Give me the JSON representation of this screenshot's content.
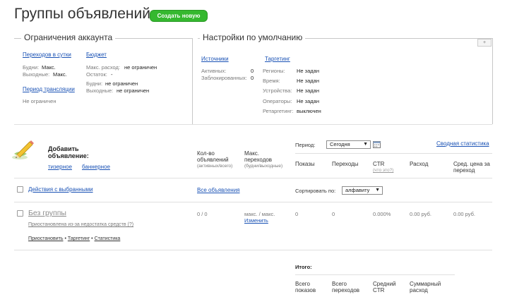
{
  "page": {
    "title": "Группы объявлений",
    "create_button": "Создать новую"
  },
  "account_limits": {
    "title": "Ограничения аккаунта",
    "clicks": {
      "link": "Переходов в сутки",
      "weekdays_label": "Будни:",
      "weekdays_value": "Макс.",
      "weekends_label": "Выходные:",
      "weekends_value": "Макс."
    },
    "budget": {
      "link": "Бюджет",
      "max_spend_label": "Макс. расход:",
      "max_spend_value": "не ограничен",
      "balance_label": "Остаток:",
      "balance_value": "-",
      "weekdays_label": "Будни:",
      "weekdays_value": "не ограничен",
      "weekends_label": "Выходные:",
      "weekends_value": "не ограничен"
    },
    "broadcast": {
      "link": "Период трансляции",
      "value": "Не ограничен"
    }
  },
  "defaults": {
    "title": "Настройки по умолчанию",
    "collapse": "+",
    "sources": {
      "link": "Источники",
      "active_label": "Активных:",
      "active_value": "0",
      "blocked_label": "Заблокированных:",
      "blocked_value": "0"
    },
    "targeting": {
      "link": "Таргетинг",
      "rows": [
        {
          "label": "Регионы:",
          "value": "Не задан"
        },
        {
          "label": "Время:",
          "value": "Не задан"
        },
        {
          "label": "Устройства:",
          "value": "Не задан"
        },
        {
          "label": "Операторы:",
          "value": "Не задан"
        },
        {
          "label": "Ретаргетинг:",
          "value": "выключен"
        }
      ]
    }
  },
  "ads": {
    "add_title": "Добавить объявление:",
    "add_teaser": "тизерное",
    "add_banner": "баннерное",
    "col_count": "Кол-во объявлений",
    "col_count_sub": "(активных/всего)",
    "col_max_clicks": "Макс. переходов",
    "col_max_clicks_sub": "(будни/выходные)",
    "period_label": "Период:",
    "period_value": "Сегодня",
    "summary_link": "Сводная статистика",
    "col_impressions": "Показы",
    "col_clicks": "Переходы",
    "col_ctr": "CTR",
    "col_ctr_sub": "(что это?)",
    "col_spend": "Расход",
    "col_avg_price": "Сред. цена за переход",
    "bulk_actions": "Действия с выбранными",
    "all_ads": "Все объявления",
    "sort_label": "Сортировать по:",
    "sort_value": "алфавиту"
  },
  "group_row": {
    "name": "Без группы",
    "status": "Приостановлена из-за недостатка средств (?)",
    "count": "0 / 0",
    "max_clicks": "макс. / макс.",
    "change": "Изменить",
    "impressions": "0",
    "clicks": "0",
    "ctr": "0.000%",
    "spend": "0.00 руб.",
    "avg_price": "0.00 руб.",
    "actions": [
      "Приостановить",
      "Таргетинг",
      "Статистика"
    ],
    "sep": "•"
  },
  "totals": {
    "title": "Итого:",
    "impressions": "Всего показов",
    "clicks": "Всего переходов",
    "ctr": "Средний CTR",
    "spend": "Суммарный расход"
  }
}
